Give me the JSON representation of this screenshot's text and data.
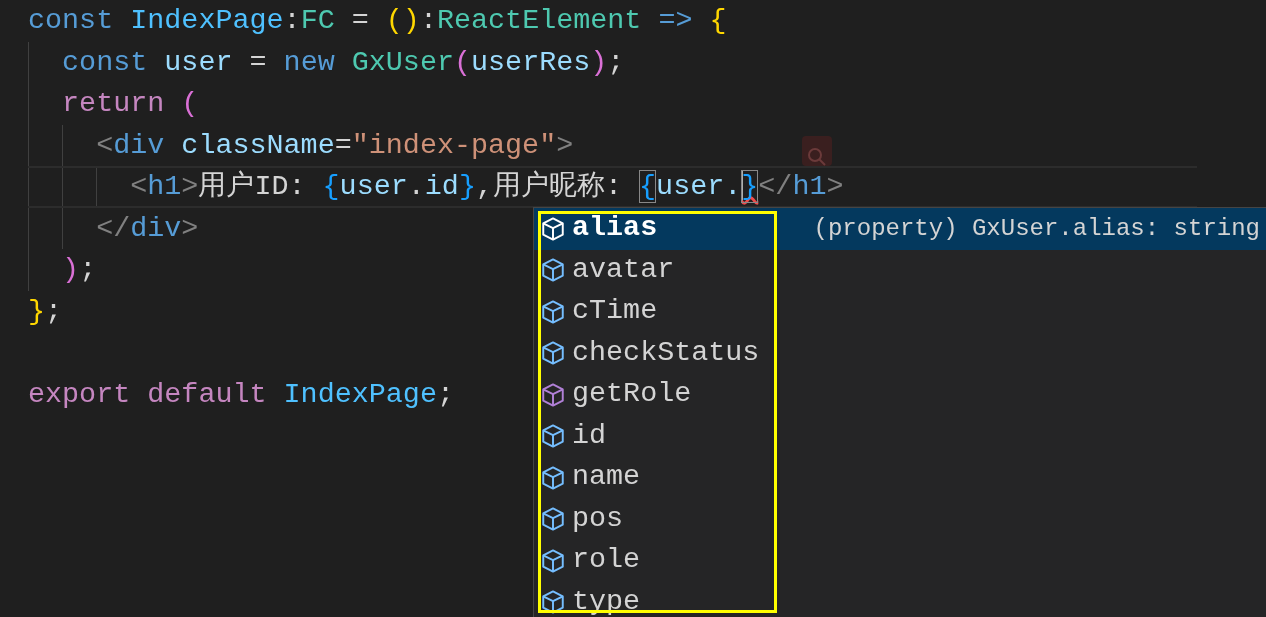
{
  "editor": {
    "lines": [
      {
        "current": false,
        "tokens": [
          {
            "text": "const ",
            "kind": "keyword"
          },
          {
            "text": "IndexPage",
            "kind": "constant"
          },
          {
            "text": ":",
            "kind": "punct"
          },
          {
            "text": "FC",
            "kind": "type"
          },
          {
            "text": " = ",
            "kind": "punct"
          },
          {
            "text": "()",
            "kind": "bracket1"
          },
          {
            "text": ":",
            "kind": "punct"
          },
          {
            "text": "ReactElement",
            "kind": "type"
          },
          {
            "text": " => ",
            "kind": "keyword"
          },
          {
            "text": "{",
            "kind": "bracket1"
          }
        ]
      },
      {
        "current": false,
        "tokens": [
          {
            "text": "  const ",
            "kind": "keyword"
          },
          {
            "text": "user",
            "kind": "variable"
          },
          {
            "text": " = ",
            "kind": "punct"
          },
          {
            "text": "new ",
            "kind": "keyword"
          },
          {
            "text": "GxUser",
            "kind": "type"
          },
          {
            "text": "(",
            "kind": "bracket2"
          },
          {
            "text": "userRes",
            "kind": "variable"
          },
          {
            "text": ")",
            "kind": "bracket2"
          },
          {
            "text": ";",
            "kind": "punct"
          }
        ]
      },
      {
        "current": false,
        "tokens": [
          {
            "text": "  return ",
            "kind": "control"
          },
          {
            "text": "(",
            "kind": "bracket2"
          }
        ]
      },
      {
        "current": false,
        "tokens": [
          {
            "text": "    <",
            "kind": "tag-punct"
          },
          {
            "text": "div ",
            "kind": "tag"
          },
          {
            "text": "className",
            "kind": "variable"
          },
          {
            "text": "=",
            "kind": "punct"
          },
          {
            "text": "\"index-page\"",
            "kind": "string"
          },
          {
            "text": ">",
            "kind": "tag-punct"
          }
        ]
      },
      {
        "current": true,
        "tokens": [
          {
            "text": "      <",
            "kind": "tag-punct"
          },
          {
            "text": "h1",
            "kind": "tag"
          },
          {
            "text": ">",
            "kind": "tag-punct"
          },
          {
            "text": "用户ID: ",
            "kind": "punct"
          },
          {
            "text": "{",
            "kind": "bracket3"
          },
          {
            "text": "user",
            "kind": "variable"
          },
          {
            "text": ".",
            "kind": "punct"
          },
          {
            "text": "id",
            "kind": "variable"
          },
          {
            "text": "}",
            "kind": "bracket3"
          },
          {
            "text": ",用户昵称: ",
            "kind": "punct"
          },
          {
            "text": "{",
            "kind": "bracket3",
            "matched": true
          },
          {
            "text": "user.",
            "kind": "variable"
          },
          {
            "text": "}",
            "kind": "bracket3",
            "matched": true,
            "cursor_before": true,
            "error": true
          },
          {
            "text": "</",
            "kind": "tag-punct"
          },
          {
            "text": "h1",
            "kind": "tag"
          },
          {
            "text": ">",
            "kind": "tag-punct"
          }
        ]
      },
      {
        "current": false,
        "tokens": [
          {
            "text": "    </",
            "kind": "tag-punct"
          },
          {
            "text": "div",
            "kind": "tag"
          },
          {
            "text": ">",
            "kind": "tag-punct"
          }
        ]
      },
      {
        "current": false,
        "tokens": [
          {
            "text": "  )",
            "kind": "bracket2"
          },
          {
            "text": ";",
            "kind": "punct"
          }
        ]
      },
      {
        "current": false,
        "tokens": [
          {
            "text": "}",
            "kind": "bracket1"
          },
          {
            "text": ";",
            "kind": "punct"
          }
        ]
      },
      {
        "current": false,
        "blank_before": true,
        "tokens": [
          {
            "text": "export ",
            "kind": "control"
          },
          {
            "text": "default ",
            "kind": "control"
          },
          {
            "text": "IndexPage",
            "kind": "constant"
          },
          {
            "text": ";",
            "kind": "punct"
          }
        ]
      }
    ]
  },
  "suggestions": {
    "detail": "(property) GxUser.alias: string",
    "items": [
      {
        "label": "alias",
        "kind": "property",
        "selected": true
      },
      {
        "label": "avatar",
        "kind": "property",
        "selected": false
      },
      {
        "label": "cTime",
        "kind": "property",
        "selected": false
      },
      {
        "label": "checkStatus",
        "kind": "property",
        "selected": false
      },
      {
        "label": "getRole",
        "kind": "method",
        "selected": false
      },
      {
        "label": "id",
        "kind": "property",
        "selected": false
      },
      {
        "label": "name",
        "kind": "property",
        "selected": false
      },
      {
        "label": "pos",
        "kind": "property",
        "selected": false
      },
      {
        "label": "role",
        "kind": "property",
        "selected": false
      },
      {
        "label": "type",
        "kind": "property",
        "selected": false
      }
    ]
  }
}
